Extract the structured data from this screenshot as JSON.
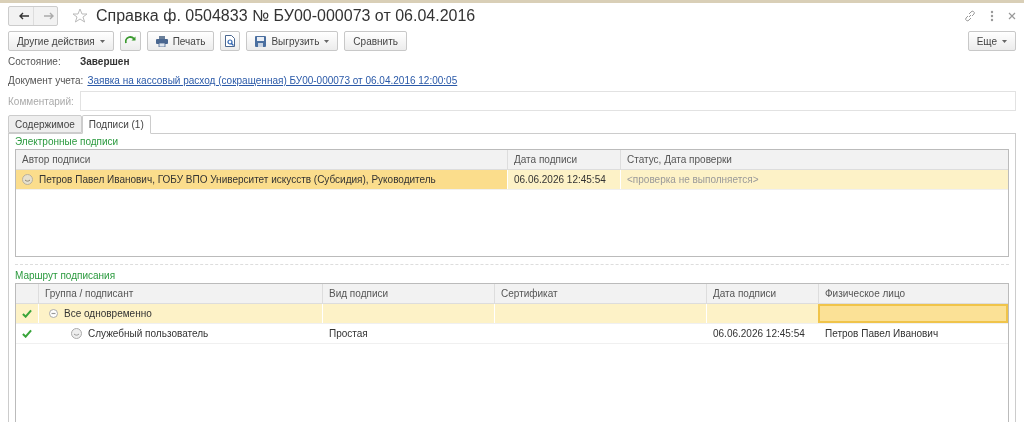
{
  "window": {
    "title": "Справка ф. 0504833 № БУ00-000073 от 06.04.2016",
    "favorite": false
  },
  "toolbar": {
    "buttons": [
      {
        "kind": "dropdown",
        "label": "Другие действия"
      },
      {
        "kind": "refresh"
      },
      {
        "kind": "print",
        "label": "Печать"
      },
      {
        "kind": "preview"
      },
      {
        "kind": "save-dropdown",
        "label": "Выгрузить"
      },
      {
        "kind": "plain",
        "label": "Сравнить"
      }
    ],
    "more": "Еще"
  },
  "fields": {
    "state": {
      "label": "Состояние:",
      "value": "Завершен"
    },
    "document": {
      "label": "Документ учета:",
      "link": "Заявка на кассовый расход (сокращенная) БУ00-000073 от 06.04.2016 12:00:05"
    },
    "comment": {
      "label": "Комментарий:",
      "disabled": true
    }
  },
  "tabs": [
    {
      "label": "Содержимое",
      "selected": false
    },
    {
      "label": "Подписи (1)",
      "selected": true
    }
  ],
  "signatures": {
    "title": "Электронные подписи",
    "columns": [
      "Автор подписи",
      "Дата подписи",
      "Статус, Дата проверки"
    ],
    "rows": [
      {
        "author": "Петров Павел Иванович, ГОБУ ВПО Университет искусств (Субсидия), Руководитель",
        "date": "06.06.2026 12:45:54",
        "status": "<проверка не выполняется>",
        "selected": true
      }
    ]
  },
  "route": {
    "title": "Маршрут подписания",
    "columns": [
      "Группа / подписант",
      "Вид подписи",
      "Сертификат",
      "Дата подписи",
      "Физическое лицо"
    ],
    "rows": [
      {
        "kind": "group",
        "name": "Все одновременно",
        "checked": true,
        "expanded": true,
        "selected": true,
        "children": [
          {
            "kind": "signer",
            "name": "Служебный пользователь",
            "checked": true,
            "selected": false,
            "sign_type": "Простая",
            "date": "06.06.2026 12:45:54",
            "person": "Петров Павел Иванович"
          }
        ]
      }
    ]
  }
}
